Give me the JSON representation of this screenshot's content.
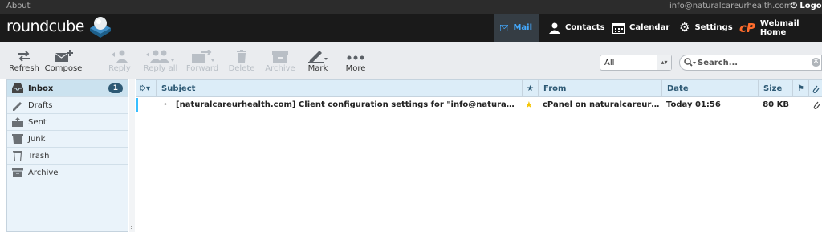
{
  "topline": {
    "about": "About",
    "user": "info@naturalcareurhealth.com",
    "logout": "Logout"
  },
  "logo": {
    "text": "roundcube"
  },
  "nav": [
    {
      "label": "Mail",
      "icon": "mail-icon",
      "active": true
    },
    {
      "label": "Contacts",
      "icon": "contacts-icon"
    },
    {
      "label": "Calendar",
      "icon": "calendar-icon"
    },
    {
      "label": "Settings",
      "icon": "gear-icon"
    },
    {
      "label": "Webmail Home",
      "icon": "cpanel-icon"
    }
  ],
  "toolbar": {
    "refresh": "Refresh",
    "compose": "Compose",
    "reply": "Reply",
    "reply_all": "Reply all",
    "forward": "Forward",
    "delete": "Delete",
    "archive": "Archive",
    "mark": "Mark",
    "more": "More"
  },
  "filter": {
    "selected": "All"
  },
  "search": {
    "placeholder": "Search..."
  },
  "folders": [
    {
      "label": "Inbox",
      "icon": "inbox-icon",
      "unread": "1",
      "selected": true
    },
    {
      "label": "Drafts",
      "icon": "drafts-icon"
    },
    {
      "label": "Sent",
      "icon": "sent-icon"
    },
    {
      "label": "Junk",
      "icon": "junk-icon"
    },
    {
      "label": "Trash",
      "icon": "trash-icon"
    },
    {
      "label": "Archive",
      "icon": "archive-icon"
    }
  ],
  "columns": {
    "subject": "Subject",
    "from": "From",
    "date": "Date",
    "size": "Size"
  },
  "messages": [
    {
      "subject": "[naturalcareurhealth.com] Client configuration settings for \"info@naturalcareur…",
      "flagged": true,
      "from": "cPanel on naturalcareurh…",
      "date": "Today 01:56",
      "size": "80 KB",
      "has_attachment": true
    }
  ],
  "colors": {
    "accent": "#37beff",
    "header_bg": "#1a1a1a",
    "toolbar_bg": "#eaecef",
    "folder_selected": "#cbe2ef",
    "badge": "#2d5974",
    "star": "#f5c400"
  }
}
